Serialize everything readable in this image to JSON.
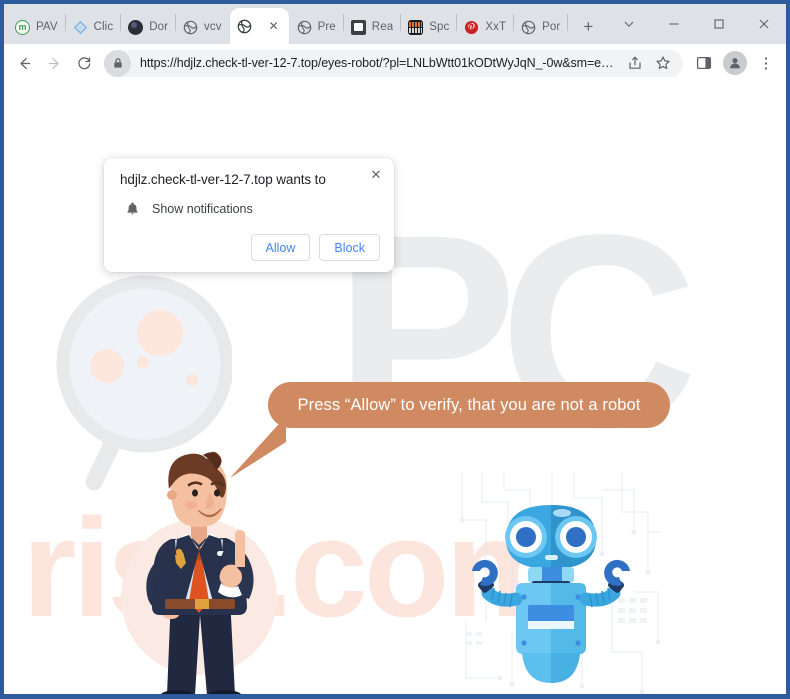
{
  "browser": {
    "tabs": [
      {
        "title": "PAV",
        "favicon": "circle-m-icon",
        "active": false
      },
      {
        "title": "Clic",
        "favicon": "diamond-icon",
        "active": false
      },
      {
        "title": "Dor",
        "favicon": "dark-circle-icon",
        "active": false
      },
      {
        "title": "vcv",
        "favicon": "globe-icon",
        "active": false
      },
      {
        "title": "",
        "favicon": "globe-icon",
        "active": true
      },
      {
        "title": "Pre",
        "favicon": "globe-icon",
        "active": false
      },
      {
        "title": "Rea",
        "favicon": "image-icon",
        "active": false
      },
      {
        "title": "Spc",
        "favicon": "pixel-icon",
        "active": false
      },
      {
        "title": "XxT",
        "favicon": "pinterest-icon",
        "active": false
      },
      {
        "title": "Por",
        "favicon": "globe-icon",
        "active": false
      }
    ],
    "new_tab_label": "+",
    "window_controls": {
      "tab_search": "tab-search-chevron",
      "minimize": "minimize",
      "maximize": "maximize",
      "close": "close"
    },
    "toolbar": {
      "back": "back-arrow",
      "forward": "forward-arrow",
      "reload": "reload-arrow",
      "url": "https://hdjlz.check-tl-ver-12-7.top/eyes-robot/?pl=LNLbWtt01kODtWyJqN_-0w&sm=e…",
      "site_info": "lock-icon",
      "share": "share-icon",
      "bookmark": "star-icon",
      "side_panel": "side-panel-icon",
      "profile": "profile-avatar-icon",
      "menu": "⋮"
    }
  },
  "dialog": {
    "title": "hdjlz.check-tl-ver-12-7.top wants to",
    "permission_label": "Show notifications",
    "permission_icon": "bell-icon",
    "allow_label": "Allow",
    "block_label": "Block",
    "close_label": "✕",
    "accent_color": "#4285f4"
  },
  "page": {
    "bubble_text": "Press “Allow” to verify, that you are not a robot",
    "bubble_color": "#d08a62",
    "watermark_primary": "PC",
    "watermark_secondary": "risk.com",
    "character_businessman": "businessman-pointing-up",
    "character_robot": "blue-robot",
    "decoration_magnifier": "magnifying-glass-germs",
    "decoration_circuit": "circuit-board-pattern"
  }
}
